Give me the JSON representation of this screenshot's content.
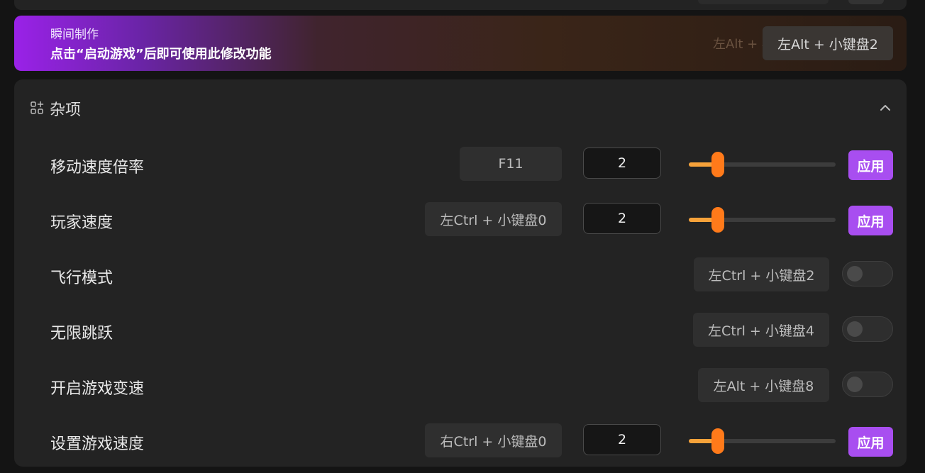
{
  "banner": {
    "title": "瞬间制作",
    "subtitle": "点击“启动游戏”后即可使用此修改功能",
    "hotkey_ghost": "左Alt + 小",
    "hotkey": "左Alt + 小键盘2"
  },
  "section": {
    "title": "杂项",
    "icon": "apps-add-icon",
    "collapse_icon": "chevron-up-icon"
  },
  "rows": [
    {
      "label": "移动速度倍率",
      "hotkey": "F11",
      "value": "2",
      "slider_fraction": 0.2,
      "apply": "应用"
    },
    {
      "label": "玩家速度",
      "hotkey": "左Ctrl + 小键盘0",
      "value": "2",
      "slider_fraction": 0.2,
      "apply": "应用"
    },
    {
      "label": "飞行模式",
      "hotkey": "左Ctrl + 小键盘2",
      "toggle": false
    },
    {
      "label": "无限跳跃",
      "hotkey": "左Ctrl + 小键盘4",
      "toggle": false
    },
    {
      "label": "开启游戏变速",
      "hotkey": "左Alt + 小键盘8",
      "toggle": false
    },
    {
      "label": "设置游戏速度",
      "hotkey": "右Ctrl + 小键盘0",
      "value": "2",
      "slider_fraction": 0.2,
      "apply": "应用"
    }
  ],
  "colors": {
    "accent_purple": "#a84ef0",
    "slider_orange": "#ff7a1a",
    "panel_bg": "#232323"
  }
}
